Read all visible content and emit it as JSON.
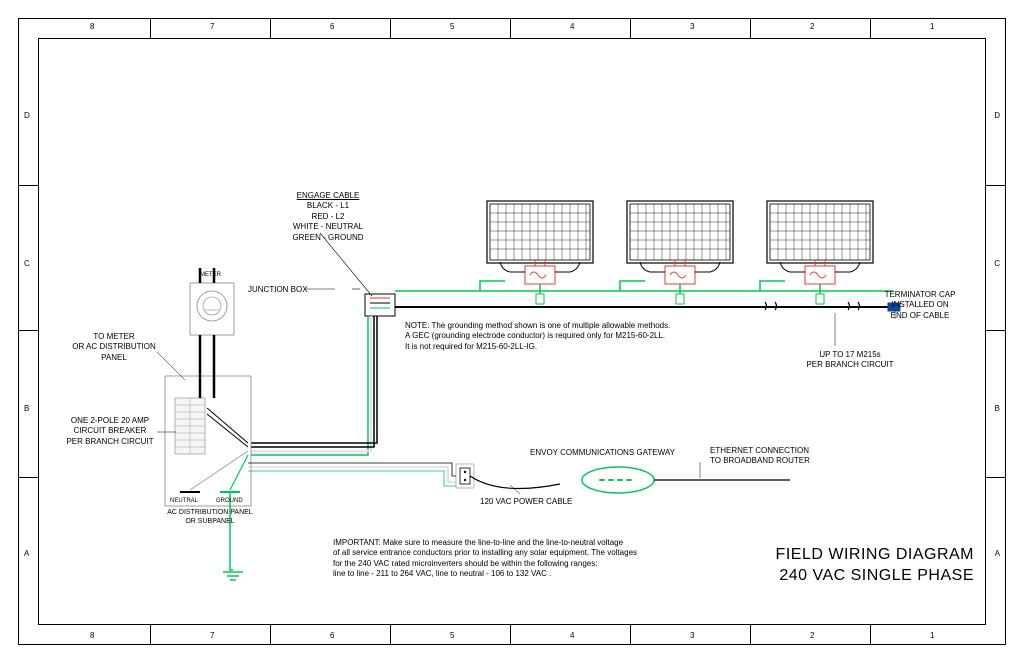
{
  "grid": {
    "cols": [
      "8",
      "7",
      "6",
      "5",
      "4",
      "3",
      "2",
      "1"
    ],
    "rows": [
      "D",
      "C",
      "B",
      "A"
    ]
  },
  "engage_cable": {
    "title": "ENGAGE CABLE",
    "l1": "BLACK - L1",
    "l2": "RED - L2",
    "neutral": "WHITE - NEUTRAL",
    "ground": "GREEN - GROUND"
  },
  "labels": {
    "junction_box": "JUNCTION BOX",
    "meter": "METER",
    "to_meter": "TO METER\nOR AC DISTRIBUTION\nPANEL",
    "breaker": "ONE 2-POLE 20 AMP\nCIRCUIT BREAKER\nPER BRANCH CIRCUIT",
    "neutral": "NEUTRAL",
    "ground": "GROUND",
    "panel": "AC DISTRIBUTION PANEL\nOR SUBPANEL",
    "envoy": "ENVOY COMMUNICATIONS GATEWAY",
    "ethernet": "ETHERNET CONNECTION\nTO BROADBAND ROUTER",
    "power_cable": "120 VAC POWER CABLE",
    "terminator": "TERMINATOR CAP\nINSTALLED ON\nEND OF CABLE",
    "branch": "UP TO 17 M215s\nPER BRANCH CIRCUIT"
  },
  "notes": {
    "grounding": "NOTE: The grounding method shown is one of multiple allowable methods.\nA GEC (grounding electrode conductor) is required only for M215-60-2LL.\nIt is not required for M215-60-2LL-IG.",
    "important": "IMPORTANT: Make sure to measure the line-to-line and the line-to-neutral voltage\nof all service entrance conductors prior to installing any solar equipment. The voltages\nfor the 240 VAC rated microinverters should be within the following ranges:\nline to line - 211 to 264 VAC, line to neutral - 106 to 132 VAC   ."
  },
  "title": {
    "line1": "FIELD WIRING DIAGRAM",
    "line2": "240 VAC SINGLE PHASE"
  }
}
